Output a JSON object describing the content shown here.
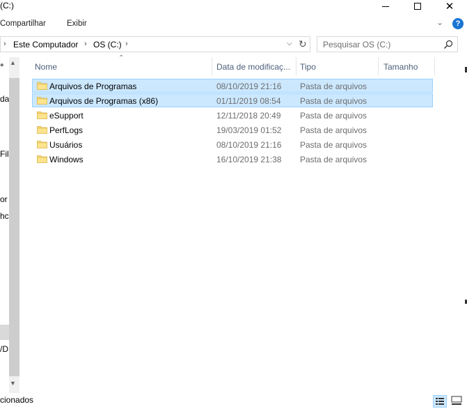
{
  "window": {
    "title": "(C:)"
  },
  "ribbon": {
    "tabs": [
      "Compartilhar",
      "Exibir"
    ]
  },
  "address": {
    "crumbs": [
      "Este Computador",
      "OS (C:)"
    ]
  },
  "search": {
    "placeholder": "Pesquisar OS (C:)"
  },
  "nav": {
    "fragments": [
      "dat",
      "Fil",
      "or",
      "hc",
      "/D"
    ]
  },
  "columns": {
    "name": "Nome",
    "date": "Data de modificaç...",
    "type": "Tipo",
    "size": "Tamanho"
  },
  "files": [
    {
      "name": "Arquivos de Programas",
      "date": "08/10/2019 21:16",
      "type": "Pasta de arquivos",
      "selected": true
    },
    {
      "name": "Arquivos de Programas (x86)",
      "date": "01/11/2019 08:54",
      "type": "Pasta de arquivos",
      "selected": true
    },
    {
      "name": "eSupport",
      "date": "12/11/2018 20:49",
      "type": "Pasta de arquivos",
      "selected": false
    },
    {
      "name": "PerfLogs",
      "date": "19/03/2019 01:52",
      "type": "Pasta de arquivos",
      "selected": false
    },
    {
      "name": "Usuários",
      "date": "08/10/2019 21:16",
      "type": "Pasta de arquivos",
      "selected": false
    },
    {
      "name": "Windows",
      "date": "16/10/2019 21:38",
      "type": "Pasta de arquivos",
      "selected": false
    }
  ],
  "status": {
    "text": "cionados"
  },
  "colors": {
    "selection_bg": "#cce8ff",
    "selection_border": "#99d1ff",
    "folder": "#f8d775",
    "header_text": "#4c607a"
  }
}
